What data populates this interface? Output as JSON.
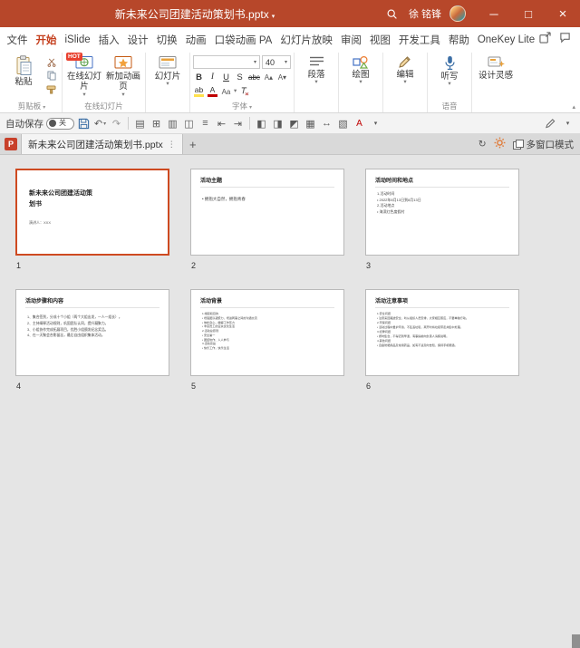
{
  "icons": {
    "undo": "↶",
    "redo": "↷",
    "sync": "↻",
    "layout": "▤",
    "table": "⊞",
    "rows": "▥",
    "columns": "◫",
    "align_text": "≡",
    "align_left": "⇤",
    "align_right": "⇥",
    "shade_left": "◧",
    "shade_right": "◨",
    "shade_corner": "◩",
    "grid": "▦",
    "distribute": "↔",
    "pattern": "▧",
    "font_color": "A",
    "highlight": "ab",
    "chevron": "▾",
    "chevron_up": "▴",
    "minimize": "─",
    "maximize": "□",
    "close": "×",
    "dots": "⋮",
    "grow_font": "A▴",
    "shrink_font": "A▾"
  },
  "titlebar": {
    "title": "新未来公司团建活动策划书.pptx",
    "user": "徐 铭锋"
  },
  "menu": {
    "tabs": [
      "文件",
      "开始",
      "iSlide",
      "插入",
      "设计",
      "切换",
      "动画",
      "口袋动画 PA",
      "幻灯片放映",
      "审阅",
      "视图",
      "开发工具",
      "帮助",
      "OneKey Lite"
    ]
  },
  "ribbon": {
    "clipboard": {
      "paste": "粘贴",
      "label": "剪贴板"
    },
    "online": {
      "slides": "在线幻灯片",
      "anim": "新加动画页",
      "badge": "HOT",
      "label": "在线幻灯片"
    },
    "slides": {
      "btn": "幻灯片"
    },
    "font": {
      "name": "",
      "size": "40",
      "bold": "B",
      "italic": "I",
      "underline": "U",
      "shadow": "S",
      "strike": "abc",
      "aa": "Aa",
      "label": "字体"
    },
    "paragraph": {
      "btn": "段落"
    },
    "drawing": {
      "btn": "绘图"
    },
    "editing": {
      "btn": "编辑"
    },
    "voice": {
      "btn": "听写",
      "label": "语音"
    },
    "design": {
      "btn": "设计灵感"
    }
  },
  "quickbar": {
    "autosave": "自动保存",
    "state": "关"
  },
  "doctabs": {
    "filename": "新未来公司团建活动策划书.pptx",
    "add": "+",
    "multi_window": "多窗口模式"
  },
  "slides": [
    {
      "number": "1",
      "title": "新未来公司团建活动策划书",
      "subtitle": "演讲人：XXX"
    },
    {
      "number": "2",
      "title": "活动主题",
      "lines": [
        "• 拥抱大自然，拥抱青春"
      ]
    },
    {
      "number": "3",
      "title": "活动时间和地点",
      "lines": [
        "1.活动时间",
        "• 2022年8月13日到8月13日",
        "2.活动地点",
        "• 海滨红色度假村"
      ]
    },
    {
      "number": "4",
      "title": "活动步骤和内容",
      "lines": [
        "1、集合签到，分成十个小组（两个大组出发，一人一组长）。",
        "2、主持阐释活动规则，巩固团队认同，提升凝聚力。",
        "3、小组协作完成拓展项目，优胜小组颁发纪念奖品。",
        "4、在一天聚会合影留念，最后自由组织集体活动。"
      ]
    },
    {
      "number": "5",
      "title": "活动背景",
      "lines": [
        "1.缘起和目的",
        "• 增强团队凝聚力，增进同事之间的沟通交流",
        "• 放松身心，缓解工作压力",
        "• 丰富员工的业余文化生活",
        "2.活动总原则",
        "• 安全第一",
        "• 团结协作、人人参与",
        "3.活动宗旨",
        "• 快乐工作，快乐生活"
      ]
    },
    {
      "number": "6",
      "title": "活动注意事项",
      "lines": [
        "1.安全问题",
        "• 注意来回路途安全，听从组织人员安排，大家相互照应，不要单独行动。",
        "2.环保问题",
        "• 活动过程中爱护环境，不乱丢垃圾，离开时将垃圾带走并集中处理。",
        "3.纪律问题",
        "• 按时集合，不得迟到早退，有事提前向负责人请假说明。",
        "4.其他问题",
        "• 自备防晒用品及常用药品，如有不适及时告知，保持手机畅通。"
      ]
    }
  ]
}
